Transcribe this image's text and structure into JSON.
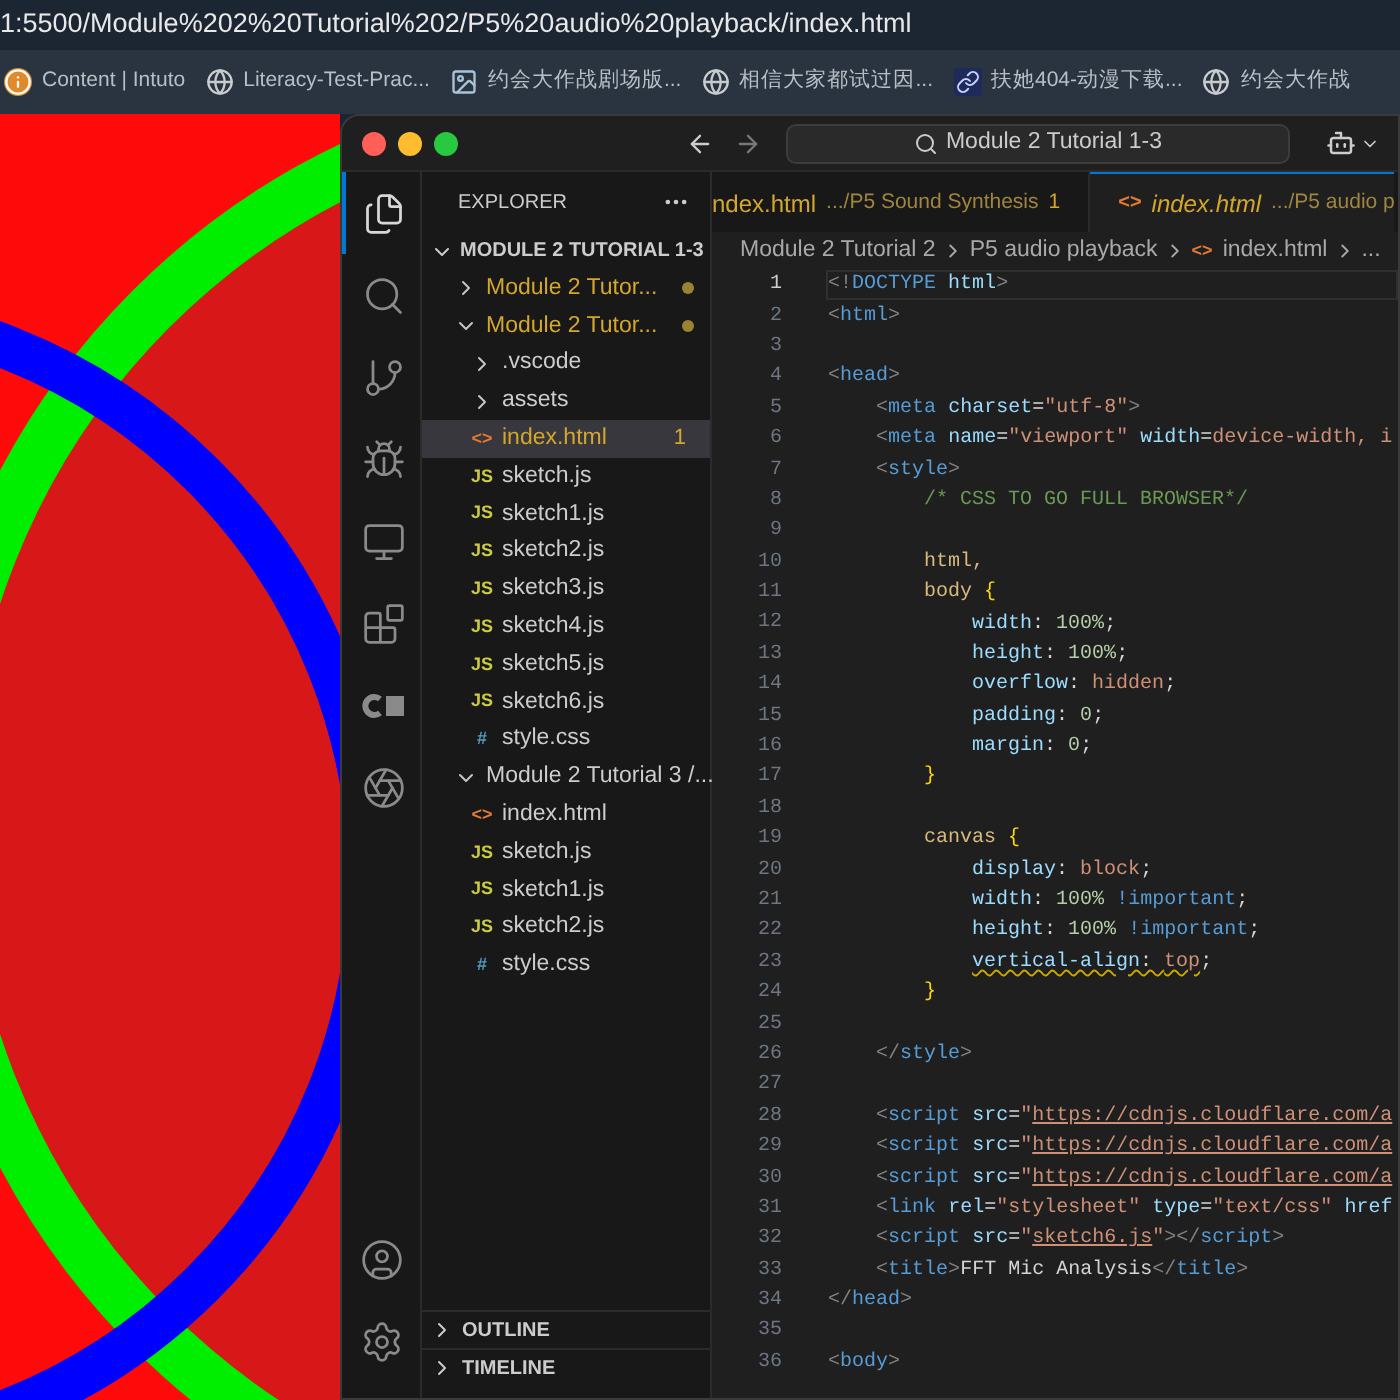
{
  "browser": {
    "url": "1:5500/Module%202%20Tutorial%202/P5%20audio%20playback/index.html",
    "bookmarks": [
      {
        "kind": "info",
        "label": "Content | Intuto"
      },
      {
        "kind": "globe",
        "label": "Literacy-Test-Prac..."
      },
      {
        "kind": "image",
        "label": "约会大作战剧场版..."
      },
      {
        "kind": "globe",
        "label": "相信大家都试过因..."
      },
      {
        "kind": "link",
        "label": "扶她404-动漫下载..."
      },
      {
        "kind": "globe",
        "label": "约会大作战"
      }
    ]
  },
  "editor_window": {
    "search": "Module 2 Tutorial 1-3",
    "activity_bar": [
      {
        "kind": "explorer",
        "selected": true
      },
      {
        "kind": "search",
        "selected": false
      },
      {
        "kind": "source-control",
        "selected": false
      },
      {
        "kind": "run-debug",
        "selected": false
      },
      {
        "kind": "remote",
        "selected": false
      },
      {
        "kind": "extensions",
        "selected": false
      },
      {
        "kind": "extension-c",
        "selected": false
      },
      {
        "kind": "chat",
        "selected": false
      }
    ],
    "activity_bottom": [
      {
        "kind": "account"
      },
      {
        "kind": "settings"
      }
    ],
    "explorer": {
      "title": "EXPLORER",
      "workspace": {
        "title": "MODULE 2 TUTORIAL 1-3",
        "expanded": true
      },
      "tree": [
        {
          "name": "Module 2 Tutor...",
          "kind": "folder",
          "expanded": false,
          "modified": true,
          "selected": false
        },
        {
          "name": "Module 2 Tutor...",
          "kind": "folder",
          "expanded": true,
          "modified": true,
          "selected": false,
          "children": [
            {
              "name": ".vscode",
              "kind": "folder",
              "expanded": false,
              "modified": false,
              "selected": false
            },
            {
              "name": "assets",
              "kind": "folder",
              "expanded": false,
              "modified": false,
              "selected": false
            },
            {
              "name": "index.html",
              "kind": "html",
              "icon": "<>",
              "modified": true,
              "selected": true,
              "badge": "1"
            },
            {
              "name": "sketch.js",
              "kind": "js",
              "icon": "JS",
              "modified": false,
              "selected": false
            },
            {
              "name": "sketch1.js",
              "kind": "js",
              "icon": "JS",
              "modified": false,
              "selected": false
            },
            {
              "name": "sketch2.js",
              "kind": "js",
              "icon": "JS",
              "modified": false,
              "selected": false
            },
            {
              "name": "sketch3.js",
              "kind": "js",
              "icon": "JS",
              "modified": false,
              "selected": false
            },
            {
              "name": "sketch4.js",
              "kind": "js",
              "icon": "JS",
              "modified": false,
              "selected": false
            },
            {
              "name": "sketch5.js",
              "kind": "js",
              "icon": "JS",
              "modified": false,
              "selected": false
            },
            {
              "name": "sketch6.js",
              "kind": "js",
              "icon": "JS",
              "modified": false,
              "selected": false
            },
            {
              "name": "style.css",
              "kind": "css",
              "icon": "#",
              "modified": false,
              "selected": false
            }
          ]
        },
        {
          "name": "Module 2 Tutorial 3 /...",
          "kind": "folder",
          "expanded": true,
          "modified": false,
          "selected": false,
          "children": [
            {
              "name": "index.html",
              "kind": "html",
              "icon": "<>",
              "modified": false,
              "selected": false
            },
            {
              "name": "sketch.js",
              "kind": "js",
              "icon": "JS",
              "modified": false,
              "selected": false
            },
            {
              "name": "sketch1.js",
              "kind": "js",
              "icon": "JS",
              "modified": false,
              "selected": false
            },
            {
              "name": "sketch2.js",
              "kind": "js",
              "icon": "JS",
              "modified": false,
              "selected": false
            },
            {
              "name": "style.css",
              "kind": "css",
              "icon": "#",
              "modified": false,
              "selected": false
            }
          ]
        }
      ],
      "sections": [
        {
          "title": "OUTLINE",
          "expanded": false
        },
        {
          "title": "TIMELINE",
          "expanded": false
        }
      ]
    },
    "tabs": [
      {
        "title": "ndex.html",
        "description": ".../P5 Sound Synthesis",
        "badge": "1",
        "preview": false,
        "selected": false
      },
      {
        "title": "index.html",
        "description": ".../P5 audio p",
        "icon": "<>",
        "preview": true,
        "selected": true
      }
    ],
    "breadcrumb": [
      {
        "label": "Module 2 Tutorial 2",
        "kind": "folder"
      },
      {
        "label": "P5 audio playback",
        "kind": "folder"
      },
      {
        "label": "index.html",
        "kind": "html"
      },
      {
        "label": "...",
        "kind": "more"
      }
    ],
    "code": [
      {
        "n": "1",
        "current": true,
        "tokens": [
          {
            "text": "<!",
            "kind": "p"
          },
          {
            "text": "DOCTYPE",
            "kind": "tag"
          },
          {
            "text": " html",
            "kind": "attr"
          },
          {
            "text": ">",
            "kind": "p"
          }
        ]
      },
      {
        "n": "2",
        "current": false,
        "tokens": [
          {
            "text": "<",
            "kind": "p"
          },
          {
            "text": "html",
            "kind": "tag"
          },
          {
            "text": ">",
            "kind": "p"
          }
        ]
      },
      {
        "n": "3",
        "current": false
      },
      {
        "n": "4",
        "current": false,
        "tokens": [
          {
            "text": "<",
            "kind": "p"
          },
          {
            "text": "head",
            "kind": "tag"
          },
          {
            "text": ">",
            "kind": "p"
          }
        ]
      },
      {
        "n": "5",
        "current": false,
        "tokens": [
          {
            "text": "    <",
            "kind": "p"
          },
          {
            "text": "meta",
            "kind": "tag"
          },
          {
            "text": " charset",
            "kind": "attr"
          },
          {
            "text": "=",
            "kind": "txt"
          },
          {
            "text": "\"utf-8\"",
            "kind": "str"
          },
          {
            "text": ">",
            "kind": "p"
          }
        ]
      },
      {
        "n": "6",
        "current": false,
        "tokens": [
          {
            "text": "    <",
            "kind": "p"
          },
          {
            "text": "meta",
            "kind": "tag"
          },
          {
            "text": " name",
            "kind": "attr"
          },
          {
            "text": "=",
            "kind": "txt"
          },
          {
            "text": "\"viewport\"",
            "kind": "str"
          },
          {
            "text": " width",
            "kind": "attr"
          },
          {
            "text": "=",
            "kind": "txt"
          },
          {
            "text": "device-width, i",
            "kind": "str"
          }
        ]
      },
      {
        "n": "7",
        "current": false,
        "tokens": [
          {
            "text": "    <",
            "kind": "p"
          },
          {
            "text": "style",
            "kind": "tag"
          },
          {
            "text": ">",
            "kind": "p"
          }
        ]
      },
      {
        "n": "8",
        "current": false,
        "tokens": [
          {
            "text": "        /* CSS TO GO FULL BROWSER*/",
            "kind": "cm"
          }
        ]
      },
      {
        "n": "9",
        "current": false
      },
      {
        "n": "10",
        "current": false,
        "tokens": [
          {
            "text": "        html,",
            "kind": "sel"
          }
        ]
      },
      {
        "n": "11",
        "current": false,
        "tokens": [
          {
            "text": "        body ",
            "kind": "sel"
          },
          {
            "text": "{",
            "kind": "br"
          }
        ]
      },
      {
        "n": "12",
        "current": false,
        "tokens": [
          {
            "text": "            width",
            "kind": "prop"
          },
          {
            "text": ": ",
            "kind": "txt"
          },
          {
            "text": "100%",
            "kind": "num"
          },
          {
            "text": ";",
            "kind": "txt"
          }
        ]
      },
      {
        "n": "13",
        "current": false,
        "tokens": [
          {
            "text": "            height",
            "kind": "prop"
          },
          {
            "text": ": ",
            "kind": "txt"
          },
          {
            "text": "100%",
            "kind": "num"
          },
          {
            "text": ";",
            "kind": "txt"
          }
        ]
      },
      {
        "n": "14",
        "current": false,
        "tokens": [
          {
            "text": "            overflow",
            "kind": "prop"
          },
          {
            "text": ": ",
            "kind": "txt"
          },
          {
            "text": "hidden",
            "kind": "val"
          },
          {
            "text": ";",
            "kind": "txt"
          }
        ]
      },
      {
        "n": "15",
        "current": false,
        "tokens": [
          {
            "text": "            padding",
            "kind": "prop"
          },
          {
            "text": ": ",
            "kind": "txt"
          },
          {
            "text": "0",
            "kind": "num"
          },
          {
            "text": ";",
            "kind": "txt"
          }
        ]
      },
      {
        "n": "16",
        "current": false,
        "tokens": [
          {
            "text": "            margin",
            "kind": "prop"
          },
          {
            "text": ": ",
            "kind": "txt"
          },
          {
            "text": "0",
            "kind": "num"
          },
          {
            "text": ";",
            "kind": "txt"
          }
        ]
      },
      {
        "n": "17",
        "current": false,
        "tokens": [
          {
            "text": "        }",
            "kind": "br"
          }
        ]
      },
      {
        "n": "18",
        "current": false
      },
      {
        "n": "19",
        "current": false,
        "tokens": [
          {
            "text": "        canvas ",
            "kind": "sel"
          },
          {
            "text": "{",
            "kind": "br"
          }
        ]
      },
      {
        "n": "20",
        "current": false,
        "tokens": [
          {
            "text": "            display",
            "kind": "prop"
          },
          {
            "text": ": ",
            "kind": "txt"
          },
          {
            "text": "block",
            "kind": "val"
          },
          {
            "text": ";",
            "kind": "txt"
          }
        ]
      },
      {
        "n": "21",
        "current": false,
        "tokens": [
          {
            "text": "            width",
            "kind": "prop"
          },
          {
            "text": ": ",
            "kind": "txt"
          },
          {
            "text": "100%",
            "kind": "num"
          },
          {
            "text": " !important",
            "kind": "kw"
          },
          {
            "text": ";",
            "kind": "txt"
          }
        ]
      },
      {
        "n": "22",
        "current": false,
        "tokens": [
          {
            "text": "            height",
            "kind": "prop"
          },
          {
            "text": ": ",
            "kind": "txt"
          },
          {
            "text": "100%",
            "kind": "num"
          },
          {
            "text": " !important",
            "kind": "kw"
          },
          {
            "text": ";",
            "kind": "txt"
          }
        ]
      },
      {
        "n": "23",
        "current": false,
        "tokens": [
          {
            "text": "            vertical-align",
            "kind": "prop"
          },
          {
            "text": ": ",
            "kind": "txt"
          },
          {
            "text": "top",
            "kind": "val"
          },
          {
            "text": ";",
            "kind": "txt"
          }
        ],
        "warning": true
      },
      {
        "n": "24",
        "current": false,
        "tokens": [
          {
            "text": "        }",
            "kind": "br"
          }
        ]
      },
      {
        "n": "25",
        "current": false
      },
      {
        "n": "26",
        "current": false,
        "tokens": [
          {
            "text": "    </",
            "kind": "p"
          },
          {
            "text": "style",
            "kind": "tag"
          },
          {
            "text": ">",
            "kind": "p"
          }
        ]
      },
      {
        "n": "27",
        "current": false
      },
      {
        "n": "28",
        "current": false,
        "tokens": [
          {
            "text": "    <",
            "kind": "p"
          },
          {
            "text": "script",
            "kind": "tag"
          },
          {
            "text": " src",
            "kind": "attr"
          },
          {
            "text": "=",
            "kind": "txt"
          },
          {
            "text": "\"",
            "kind": "str"
          },
          {
            "text": "https://cdnjs.cloudflare.com/a",
            "kind": "url"
          }
        ]
      },
      {
        "n": "29",
        "current": false,
        "tokens": [
          {
            "text": "    <",
            "kind": "p"
          },
          {
            "text": "script",
            "kind": "tag"
          },
          {
            "text": " src",
            "kind": "attr"
          },
          {
            "text": "=",
            "kind": "txt"
          },
          {
            "text": "\"",
            "kind": "str"
          },
          {
            "text": "https://cdnjs.cloudflare.com/a",
            "kind": "url"
          }
        ]
      },
      {
        "n": "30",
        "current": false,
        "tokens": [
          {
            "text": "    <",
            "kind": "p"
          },
          {
            "text": "script",
            "kind": "tag"
          },
          {
            "text": " src",
            "kind": "attr"
          },
          {
            "text": "=",
            "kind": "txt"
          },
          {
            "text": "\"",
            "kind": "str"
          },
          {
            "text": "https://cdnjs.cloudflare.com/a",
            "kind": "url"
          }
        ]
      },
      {
        "n": "31",
        "current": false,
        "tokens": [
          {
            "text": "    <",
            "kind": "p"
          },
          {
            "text": "link",
            "kind": "tag"
          },
          {
            "text": " rel",
            "kind": "attr"
          },
          {
            "text": "=",
            "kind": "txt"
          },
          {
            "text": "\"stylesheet\"",
            "kind": "str"
          },
          {
            "text": " type",
            "kind": "attr"
          },
          {
            "text": "=",
            "kind": "txt"
          },
          {
            "text": "\"text/css\"",
            "kind": "str"
          },
          {
            "text": " href",
            "kind": "attr"
          }
        ]
      },
      {
        "n": "32",
        "current": false,
        "tokens": [
          {
            "text": "    <",
            "kind": "p"
          },
          {
            "text": "script",
            "kind": "tag"
          },
          {
            "text": " src",
            "kind": "attr"
          },
          {
            "text": "=",
            "kind": "txt"
          },
          {
            "text": "\"",
            "kind": "str"
          },
          {
            "text": "sketch6.js",
            "kind": "url"
          },
          {
            "text": "\"",
            "kind": "str"
          },
          {
            "text": "></",
            "kind": "p"
          },
          {
            "text": "script",
            "kind": "tag"
          },
          {
            "text": ">",
            "kind": "p"
          }
        ]
      },
      {
        "n": "33",
        "current": false,
        "tokens": [
          {
            "text": "    <",
            "kind": "p"
          },
          {
            "text": "title",
            "kind": "tag"
          },
          {
            "text": ">",
            "kind": "p"
          },
          {
            "text": "FFT Mic Analysis",
            "kind": "txt"
          },
          {
            "text": "</",
            "kind": "p"
          },
          {
            "text": "title",
            "kind": "tag"
          },
          {
            "text": ">",
            "kind": "p"
          }
        ]
      },
      {
        "n": "34",
        "current": false,
        "tokens": [
          {
            "text": "</",
            "kind": "p"
          },
          {
            "text": "head",
            "kind": "tag"
          },
          {
            "text": ">",
            "kind": "p"
          }
        ]
      },
      {
        "n": "35",
        "current": false
      },
      {
        "n": "36",
        "current": false,
        "tokens": [
          {
            "text": "<",
            "kind": "p"
          },
          {
            "text": "body",
            "kind": "tag"
          },
          {
            "text": ">",
            "kind": "p"
          }
        ]
      }
    ]
  }
}
